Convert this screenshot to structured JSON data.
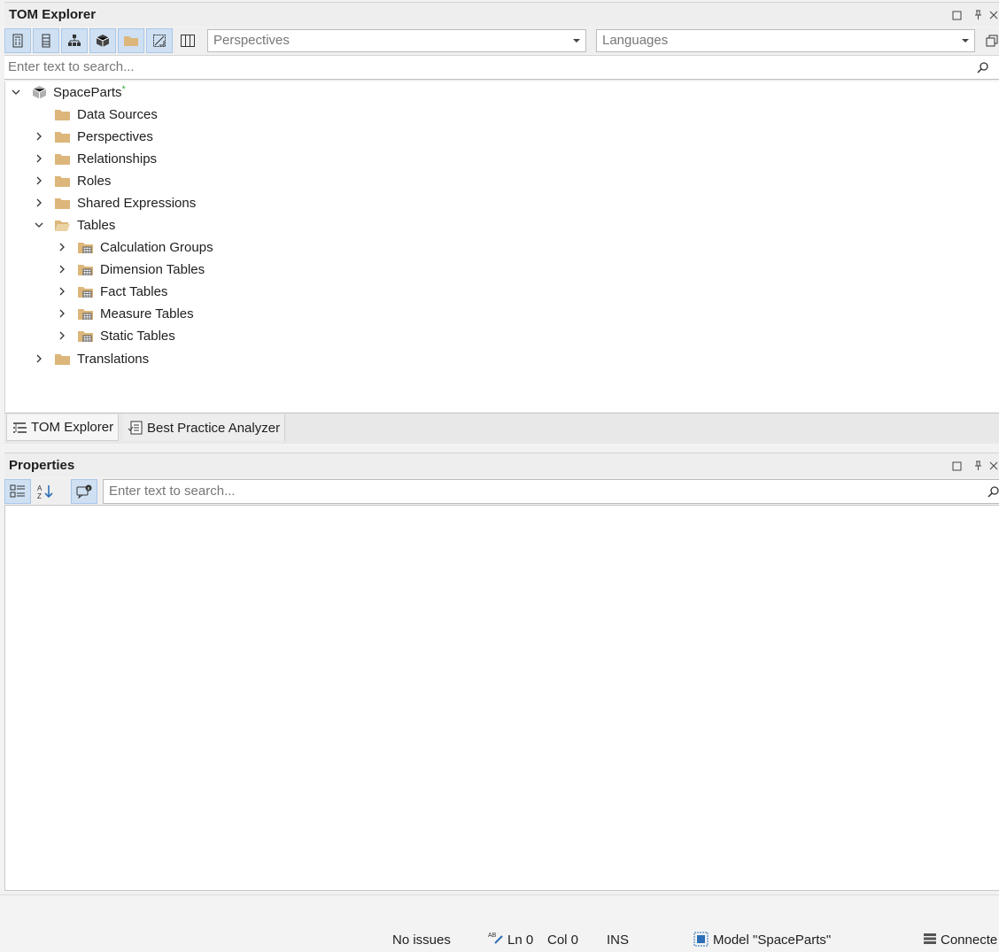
{
  "tom_explorer": {
    "title": "TOM Explorer",
    "perspectives_placeholder": "Perspectives",
    "languages_placeholder": "Languages",
    "search_placeholder": "Enter text to search...",
    "tree": {
      "root": {
        "label": "SpaceParts",
        "modified_mark": "*"
      },
      "data_sources": "Data Sources",
      "perspectives": "Perspectives",
      "relationships": "Relationships",
      "roles": "Roles",
      "shared_expressions": "Shared Expressions",
      "tables": "Tables",
      "table_groups": [
        "Calculation Groups",
        "Dimension Tables",
        "Fact Tables",
        "Measure Tables",
        "Static Tables"
      ],
      "translations": "Translations"
    },
    "tabs": [
      "TOM Explorer",
      "Best Practice Analyzer"
    ]
  },
  "properties": {
    "title": "Properties",
    "search_placeholder": "Enter text to search..."
  },
  "status_bar": {
    "issues": "No issues",
    "line": "Ln 0",
    "column": "Col 0",
    "mode": "INS",
    "model": "Model \"SpaceParts\"",
    "connection": "Connecte"
  },
  "colors": {
    "folder": "#dcb67a",
    "selected_tool": "#cfe0f3",
    "modified": "#3cb043"
  }
}
